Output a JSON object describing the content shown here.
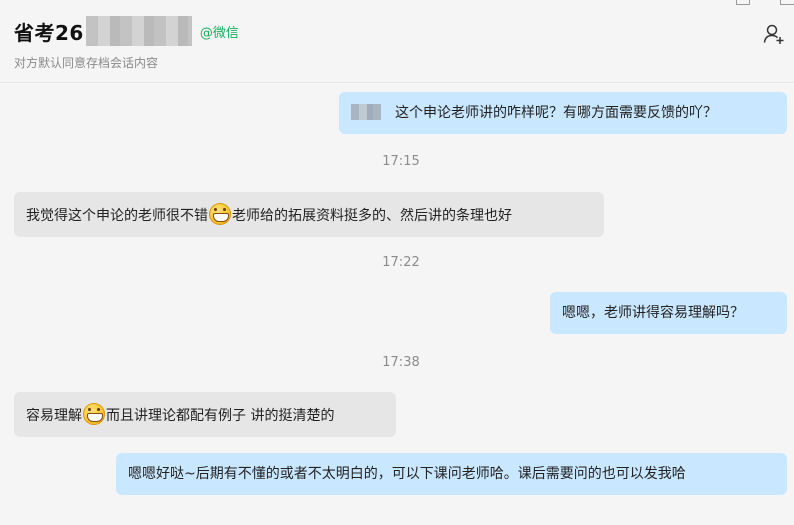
{
  "window": {
    "title": "省考26",
    "title_source": "@微信",
    "subtitle": "对方默认同意存档会话内容"
  },
  "icons": {
    "add_member": "add-member-icon",
    "emoji": "grinning-emoji-icon"
  },
  "colors": {
    "outgoing_bubble": "#c9e7ff",
    "incoming_bubble": "#e6e6e6",
    "source_tag": "#1aad5e",
    "timestamp": "#8c8c8c"
  },
  "messages": [
    {
      "type": "out",
      "text": "这个申论老师讲的咋样呢？有哪方面需要反馈的吖？"
    },
    {
      "type": "time",
      "text": "17:15"
    },
    {
      "type": "in",
      "text_before": "我觉得这个申论的老师很不错",
      "text_after": "老师给的拓展资料挺多的、然后讲的条理也好"
    },
    {
      "type": "time",
      "text": "17:22"
    },
    {
      "type": "out",
      "text": "嗯嗯，老师讲得容易理解吗？"
    },
    {
      "type": "time",
      "text": "17:38"
    },
    {
      "type": "in",
      "text_before": "容易理解",
      "text_after": "而且讲理论都配有例子 讲的挺清楚的"
    },
    {
      "type": "out",
      "text": "嗯嗯好哒~后期有不懂的或者不太明白的，可以下课问老师哈。课后需要问的也可以发我哈"
    }
  ]
}
